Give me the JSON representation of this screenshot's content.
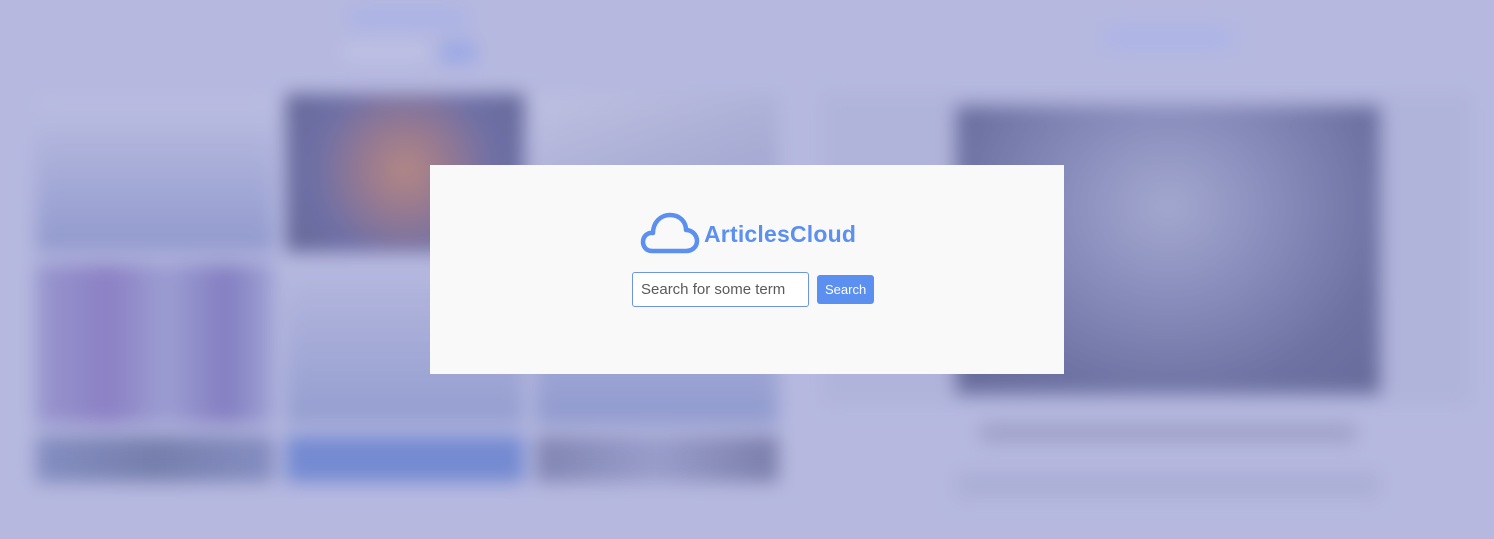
{
  "colors": {
    "brand": "#5b8ff0",
    "modal_background": "#f9f9f9",
    "page_overlay": "#b7b9de"
  },
  "modal": {
    "logo": {
      "icon": "cloud-icon",
      "text": "ArticlesCloud"
    },
    "search": {
      "placeholder": "Search for some term",
      "value": "",
      "button_label": "Search"
    }
  }
}
